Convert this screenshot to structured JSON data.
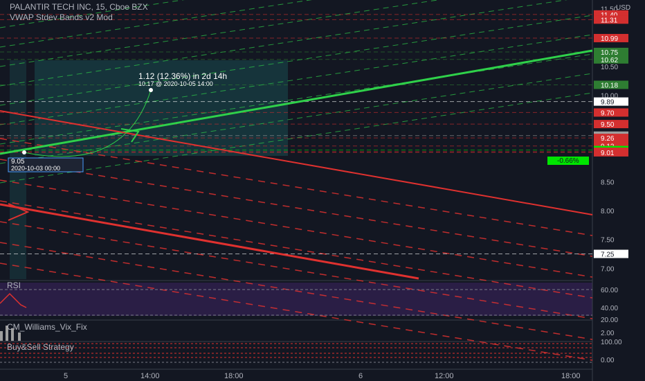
{
  "header": {
    "symbol_line": "PALANTIR TECH INC, 15, Cboe BZX",
    "indicator": "VWAP Stdev Bands v2 Mod",
    "currency": "USD"
  },
  "annotation": {
    "measure_text": "1.12 (12.36%) in 2d 14h",
    "end_point": "10.17 @ 2020-10-05  14:00",
    "start_value": "9.05",
    "start_time": "2020-10-03 00:00"
  },
  "price_axis": {
    "ticks": [
      "11.50",
      "11.00",
      "10.50",
      "10.00",
      "9.50",
      "9.00",
      "8.50",
      "8.00",
      "7.50",
      "7.00"
    ],
    "badges": [
      {
        "text": "11.40",
        "color": "#d32f2f"
      },
      {
        "text": "11.31",
        "color": "#d32f2f"
      },
      {
        "text": "10.99",
        "color": "#d32f2f"
      },
      {
        "text": "10.75",
        "color": "#2e7d32"
      },
      {
        "text": "10.62",
        "color": "#2e7d32"
      },
      {
        "text": "10.18",
        "color": "#2e7d32"
      },
      {
        "text": "9.89",
        "color": "#ffffff"
      },
      {
        "text": "9.70",
        "color": "#d32f2f"
      },
      {
        "text": "9.50",
        "color": "#d32f2f"
      },
      {
        "text": "9.30",
        "color": "#9e9e9e"
      },
      {
        "text": "9.26",
        "color": "#d32f2f"
      },
      {
        "text": "9.12",
        "color": "#d32f2f"
      },
      {
        "text": "9.05",
        "color": "#00e600"
      },
      {
        "text": "9.02",
        "color": "#d32f2f"
      },
      {
        "text": "9.01",
        "color": "#d32f2f"
      },
      {
        "text": "7.25",
        "color": "#ffffff"
      }
    ],
    "change_badge": "-0.66%"
  },
  "panes": {
    "rsi": {
      "label": "RSI",
      "ticks": [
        "60.00",
        "40.00",
        "20.00"
      ]
    },
    "vix": {
      "label": "CM_Williams_Vix_Fix",
      "ticks": [
        "2.00"
      ]
    },
    "strategy": {
      "label": "Buy&Sell Strategy",
      "ticks": [
        "100.00",
        "0.00"
      ]
    }
  },
  "time_axis": {
    "ticks": [
      "5",
      "14:00",
      "18:00",
      "6",
      "12:00",
      "18:00"
    ]
  },
  "colors": {
    "bg": "#131722",
    "green": "#2fd14a",
    "red": "#e0312f",
    "panel": "#2a1e45"
  },
  "chart_data": {
    "type": "line",
    "title": "PALANTIR TECH INC, 15, Cboe BZX",
    "ylabel": "USD",
    "ylim": [
      6.8,
      11.65
    ],
    "series": [
      {
        "name": "VWAP Stdev Bands v2 Mod",
        "values": []
      }
    ],
    "price_levels": [
      11.4,
      11.31,
      10.99,
      10.75,
      10.62,
      10.18,
      9.89,
      9.7,
      9.5,
      9.3,
      9.26,
      9.12,
      9.05,
      9.02,
      9.01,
      7.25
    ],
    "measure": {
      "from": 9.05,
      "to": 10.17,
      "change": 1.12,
      "change_pct": 12.36
    }
  }
}
